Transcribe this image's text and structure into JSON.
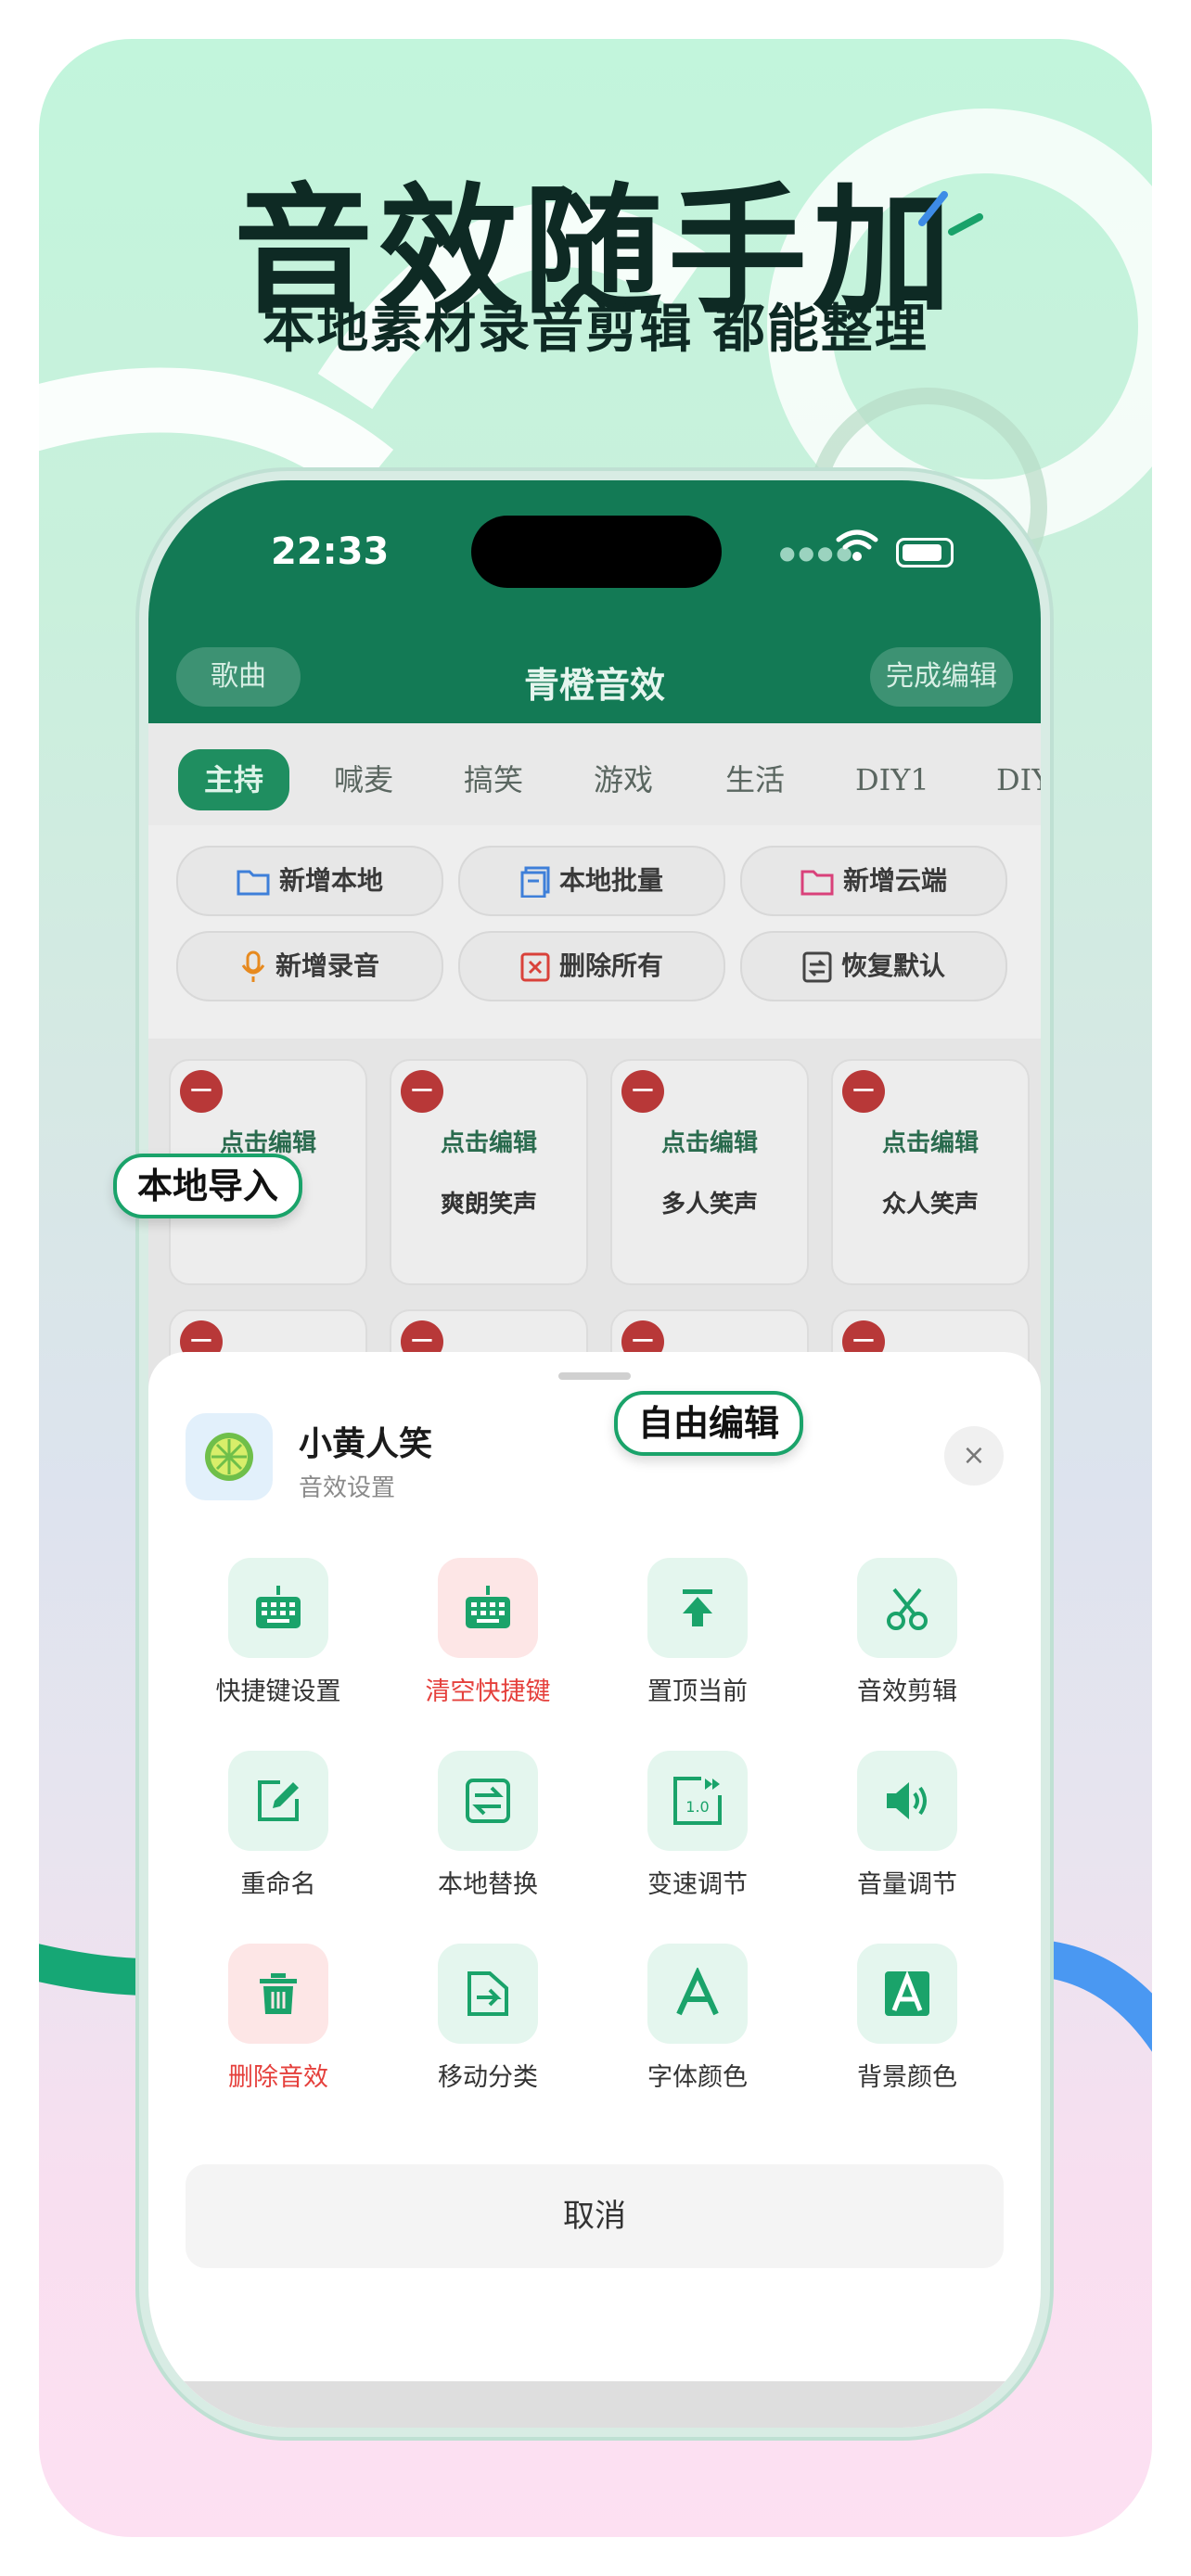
{
  "promo": {
    "headline": "音效随手加",
    "subhead": "本地素材录音剪辑  都能整理"
  },
  "status_bar": {
    "time": "22:33"
  },
  "app_header": {
    "left_button": "歌曲",
    "title": "青橙音效",
    "right_button": "完成编辑"
  },
  "tabs": [
    "主持",
    "喊麦",
    "搞笑",
    "游戏",
    "生活",
    "DIY1",
    "DIY"
  ],
  "actions": [
    {
      "label": "新增本地",
      "icon": "folder-icon"
    },
    {
      "label": "本地批量",
      "icon": "batch-icon"
    },
    {
      "label": "新增云端",
      "icon": "cloud-folder-icon"
    },
    {
      "label": "新增录音",
      "icon": "microphone-icon"
    },
    {
      "label": "删除所有",
      "icon": "delete-all-icon"
    },
    {
      "label": "恢复默认",
      "icon": "restore-icon"
    }
  ],
  "tiles": {
    "edit_label": "点击编辑",
    "row1": [
      "",
      "爽朗笑声",
      "多人笑声",
      "众人笑声"
    ]
  },
  "sheet": {
    "title": "小黄人笑",
    "subtitle": "音效设置",
    "close": "×",
    "options": [
      {
        "label": "快捷键设置",
        "icon": "keyboard-icon",
        "danger": false
      },
      {
        "label": "清空快捷键",
        "icon": "keyboard-clear-icon",
        "danger": true
      },
      {
        "label": "置顶当前",
        "icon": "pin-top-icon",
        "danger": false
      },
      {
        "label": "音效剪辑",
        "icon": "scissors-icon",
        "danger": false
      },
      {
        "label": "重命名",
        "icon": "edit-icon",
        "danger": false
      },
      {
        "label": "本地替换",
        "icon": "replace-icon",
        "danger": false
      },
      {
        "label": "变速调节",
        "icon": "speed-icon",
        "danger": false
      },
      {
        "label": "音量调节",
        "icon": "volume-icon",
        "danger": false
      },
      {
        "label": "删除音效",
        "icon": "trash-icon",
        "danger": true
      },
      {
        "label": "移动分类",
        "icon": "move-icon",
        "danger": false
      },
      {
        "label": "字体颜色",
        "icon": "font-color-icon",
        "danger": false
      },
      {
        "label": "背景颜色",
        "icon": "background-color-icon",
        "danger": false
      }
    ],
    "speed_value": "1.0",
    "cancel": "取消"
  },
  "callouts": {
    "local_import": "本地导入",
    "free_edit": "自由编辑"
  },
  "colors": {
    "accent": "#1aa36a",
    "header": "#137a55",
    "danger": "#e5403c"
  }
}
